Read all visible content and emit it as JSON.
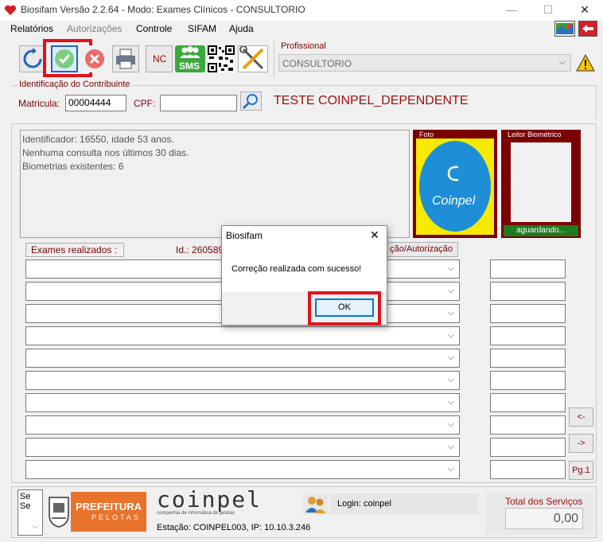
{
  "window": {
    "title": "Biosifam Versão 2.2.64 - Modo: Exames Clínicos - CONSULTORIO",
    "minimize": "—",
    "maximize": "☐",
    "close": "✕"
  },
  "menu": {
    "items": [
      {
        "label": "Relatórios",
        "enabled": true
      },
      {
        "label": "Autorizações",
        "enabled": false
      },
      {
        "label": "Controle",
        "enabled": true
      },
      {
        "label": "SIFAM",
        "enabled": true
      },
      {
        "label": "Ajuda",
        "enabled": true
      }
    ]
  },
  "toolbar": {
    "nc_label": "NC",
    "sms_label": "SMS"
  },
  "professional": {
    "group_label": "Profissional",
    "value": "CONSULTORIO"
  },
  "contributor": {
    "group_label": "Identificação do Contribuinte",
    "matricula_label": "Matricula:",
    "matricula_value": "00004444",
    "cpf_label": "CPF:",
    "cpf_value": "",
    "name": "TESTE COINPEL_DEPENDENTE"
  },
  "info": {
    "lines": [
      "Identificador: 16550, idade 53 anos.",
      "Nenhuma consulta nos últimos 30 dias.",
      "Biometrias existentes: 6"
    ]
  },
  "photo": {
    "label": "Foto",
    "logo_text": "Coinpel"
  },
  "biometric": {
    "label": "Leitor Biométrico",
    "status": "aguardando..."
  },
  "exams": {
    "label": "Exames realizados :",
    "id_text": "Id.: 260589",
    "auth_button": "ção/Autorização",
    "rows": 10
  },
  "nav": {
    "prev": "<-",
    "next": "->",
    "page": "Pg.1"
  },
  "footer": {
    "side_lines": [
      "Se",
      "Se"
    ],
    "prefeitura_title": "PREFEITURA",
    "prefeitura_sub": "PELOTAS",
    "coinpel_brand": "coinpel",
    "coinpel_sub": "companhia de informática de pelotas",
    "login_text": "Login: coinpel",
    "station_text": "Estação: COINPEL003, IP: 10.10.3.246",
    "total_label": "Total dos Serviços",
    "total_value": "0,00"
  },
  "dialog": {
    "title": "Biosifam",
    "message": "Correção realizada com sucesso!",
    "ok_label": "OK",
    "close": "✕"
  },
  "colors": {
    "dark_red": "#7a0000",
    "highlight_red": "#e0131c",
    "photo_yellow": "#f5ea00",
    "logo_blue": "#1e8fd6",
    "biometric_green": "#1f7a1f"
  }
}
